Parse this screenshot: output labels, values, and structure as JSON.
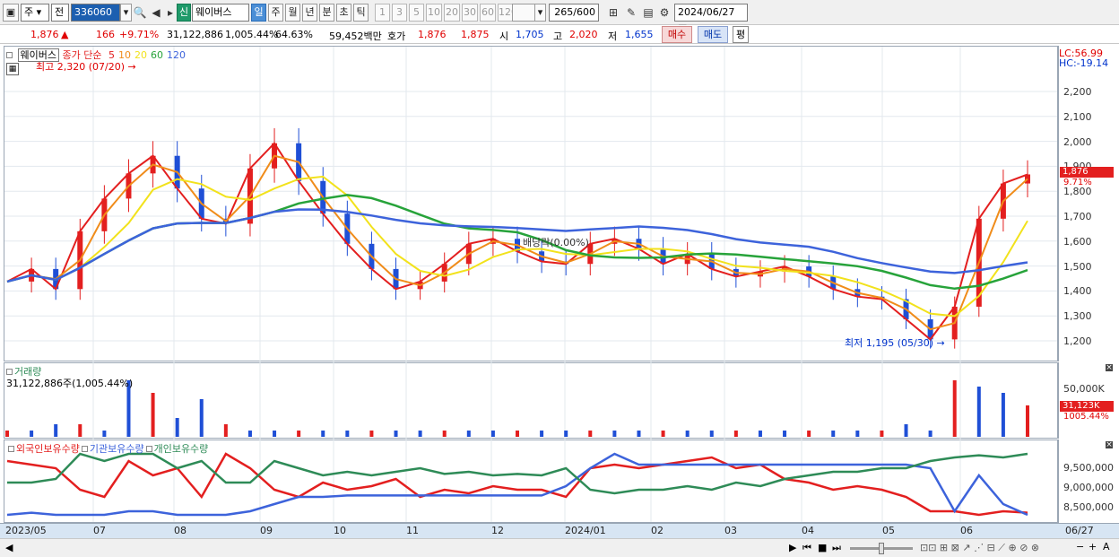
{
  "toolbar": {
    "market_label": "주",
    "type_label": "전",
    "code_value": "336060",
    "stock_name": "웨이버스",
    "credit_badge": "신",
    "period_tabs": [
      "일",
      "주",
      "월",
      "년",
      "분",
      "초",
      "틱"
    ],
    "active_period": "일",
    "interval_buttons": [
      "1",
      "3",
      "5",
      "10",
      "20",
      "30",
      "60",
      "120"
    ],
    "count_value": "265",
    "count_max": "/600",
    "date_value": "2024/06/27"
  },
  "quote": {
    "price": "1,876",
    "change_arrow": "▲",
    "change": "166",
    "change_pct": "+9.71%",
    "volume": "31,122,886",
    "volume_pct": "1,005.44%",
    "turnover_pct": "64.63%",
    "amount": "59,452백만",
    "bid_label": "호가",
    "ask": "1,876",
    "bid": "1,875",
    "open_label": "시",
    "open": "1,705",
    "high_label": "고",
    "high": "2,020",
    "low_label": "저",
    "low": "1,655",
    "buy_button": "매수",
    "sell_button": "매도",
    "eval_button": "평"
  },
  "price_pane": {
    "stock_name": "웨이버스",
    "ma_title": "종가 단순",
    "ma_periods": [
      "5",
      "10",
      "20",
      "60",
      "120"
    ],
    "ma_colors": [
      "#e31f1f",
      "#f08c1a",
      "#f2e21c",
      "#27a33a",
      "#3d63db"
    ],
    "high_annotation": "최고 2,320 (07/20)",
    "low_annotation": "최저 1,195 (05/30)",
    "dividend_annotation": "배당락(0.00%)",
    "lc_label": "LC:56.99",
    "hc_label": "HC:-19.14",
    "price_ticks": [
      "2,200",
      "2,100",
      "2,000",
      "1,900",
      "1,800",
      "1,700",
      "1,600",
      "1,500",
      "1,400",
      "1,300",
      "1,200"
    ],
    "current_price_tag": "1,876",
    "current_pct_tag": "9.71%"
  },
  "volume_pane": {
    "title": "거래량",
    "value_text": "31,122,886주(1,005.44%)",
    "tick": "50,000K",
    "current_tag": "31,123K",
    "current_pct": "1005.44%"
  },
  "holdings_pane": {
    "legend": [
      "외국인보유수량",
      "기관보유수량",
      "개인보유수량"
    ],
    "legend_colors": [
      "#e31f1f",
      "#3d63db",
      "#2e8b57"
    ],
    "ticks": [
      "9,500,000",
      "9,000,000",
      "8,500,000"
    ]
  },
  "date_axis": {
    "labels": [
      "2023/05",
      "07",
      "08",
      "09",
      "10",
      "11",
      "12",
      "2024/01",
      "02",
      "03",
      "04",
      "05",
      "06",
      "06/27"
    ]
  },
  "chart_data": {
    "type": "candlestick",
    "title": "웨이버스",
    "ylim": [
      1150,
      2320
    ],
    "points": [
      [
        "2023/05",
        1450
      ],
      [
        "2023/05",
        1500
      ],
      [
        "2023/06",
        1420
      ],
      [
        "2023/06",
        1650
      ],
      [
        "2023/07",
        1780
      ],
      [
        "2023/07",
        1880
      ],
      [
        "2023/07",
        1950
      ],
      [
        "2023/08",
        1820
      ],
      [
        "2023/08",
        1700
      ],
      [
        "2023/08",
        1680
      ],
      [
        "2023/09",
        1900
      ],
      [
        "2023/09",
        2000
      ],
      [
        "2023/09",
        1850
      ],
      [
        "2023/10",
        1720
      ],
      [
        "2023/10",
        1600
      ],
      [
        "2023/10",
        1500
      ],
      [
        "2023/10",
        1420
      ],
      [
        "2023/11",
        1450
      ],
      [
        "2023/11",
        1520
      ],
      [
        "2023/11",
        1600
      ],
      [
        "2023/12",
        1620
      ],
      [
        "2023/12",
        1570
      ],
      [
        "2023/12",
        1530
      ],
      [
        "2024/01",
        1520
      ],
      [
        "2024/01",
        1600
      ],
      [
        "2024/01",
        1620
      ],
      [
        "2024/02",
        1580
      ],
      [
        "2024/02",
        1520
      ],
      [
        "2024/02",
        1560
      ],
      [
        "2024/03",
        1500
      ],
      [
        "2024/03",
        1470
      ],
      [
        "2024/03",
        1490
      ],
      [
        "2024/04",
        1510
      ],
      [
        "2024/04",
        1470
      ],
      [
        "2024/04",
        1420
      ],
      [
        "2024/05",
        1390
      ],
      [
        "2024/05",
        1380
      ],
      [
        "2024/05",
        1300
      ],
      [
        "2024/05",
        1220
      ],
      [
        "2024/06",
        1350
      ],
      [
        "2024/06",
        1700
      ],
      [
        "2024/06",
        1840
      ],
      [
        "2024/06",
        1876
      ]
    ],
    "volume_series": [
      0.1,
      0.1,
      0.2,
      0.2,
      0.1,
      0.9,
      0.7,
      0.3,
      0.6,
      0.2,
      0.1,
      0.1,
      0.1,
      0.1,
      0.1,
      0.1,
      0.1,
      0.1,
      0.1,
      0.1,
      0.1,
      0.1,
      0.1,
      0.1,
      0.1,
      0.1,
      0.1,
      0.1,
      0.1,
      0.1,
      0.1,
      0.1,
      0.1,
      0.1,
      0.1,
      0.1,
      0.1,
      0.2,
      0.1,
      0.9,
      0.8,
      0.7,
      0.5
    ],
    "xlabel": "",
    "ylabel": ""
  }
}
